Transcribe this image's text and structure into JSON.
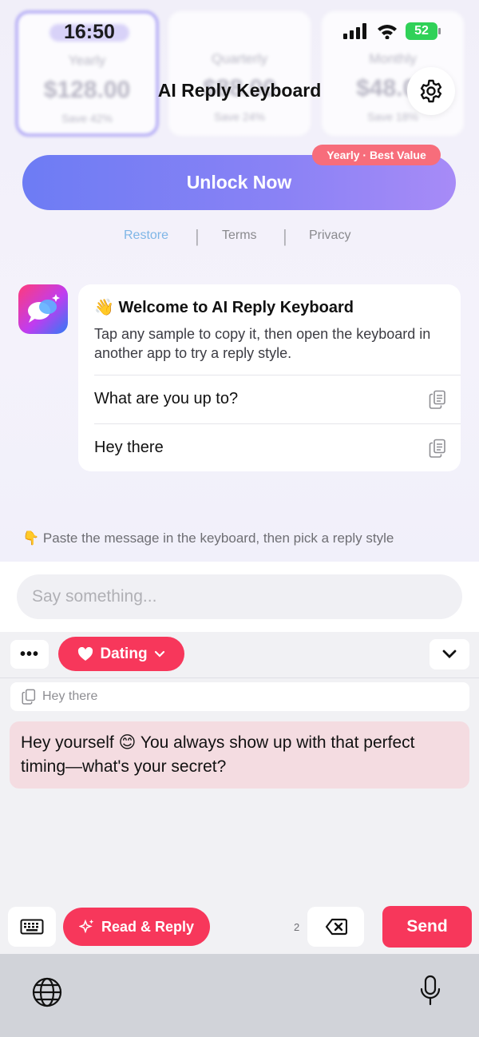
{
  "status_bar": {
    "time": "16:50",
    "battery": "52"
  },
  "plans": [
    {
      "name": "Yearly",
      "price": "$128.00",
      "save": "Save 42%"
    },
    {
      "name": "Quarterly",
      "price": "$88.00",
      "save": "Save 24%"
    },
    {
      "name": "Monthly",
      "price": "$48.00",
      "save": "Save 18%"
    }
  ],
  "header": {
    "title": "AI Reply Keyboard"
  },
  "paywall": {
    "unlock_label": "Unlock Now",
    "badge": "Yearly · Best Value",
    "restore": "Restore",
    "terms": "Terms",
    "privacy": "Privacy",
    "separator": "|"
  },
  "welcome": {
    "emoji": "👋",
    "title": "Welcome to AI Reply Keyboard",
    "body": "Tap any sample to copy it, then open the keyboard in another app to try a reply style.",
    "samples": [
      "What are you up to?",
      "Hey there"
    ]
  },
  "hint": {
    "emoji": "👇",
    "text": "Paste the message in the keyboard, then pick a reply style"
  },
  "composer": {
    "placeholder": "Say something...",
    "value": ""
  },
  "keyboard": {
    "more": "•••",
    "style_label": "Dating",
    "quoted_message": "Hey there",
    "reply_text": "Hey yourself 😊 You always show up with that perfect timing—what's your secret?",
    "read_reply_label": "Read & Reply",
    "count": "2",
    "send_label": "Send"
  },
  "colors": {
    "accent": "#f7375b",
    "unlock_start": "#6d7cf4",
    "unlock_end": "#a78bf7",
    "badge": "#f76d7b",
    "reply_bg": "#f4dce1"
  }
}
